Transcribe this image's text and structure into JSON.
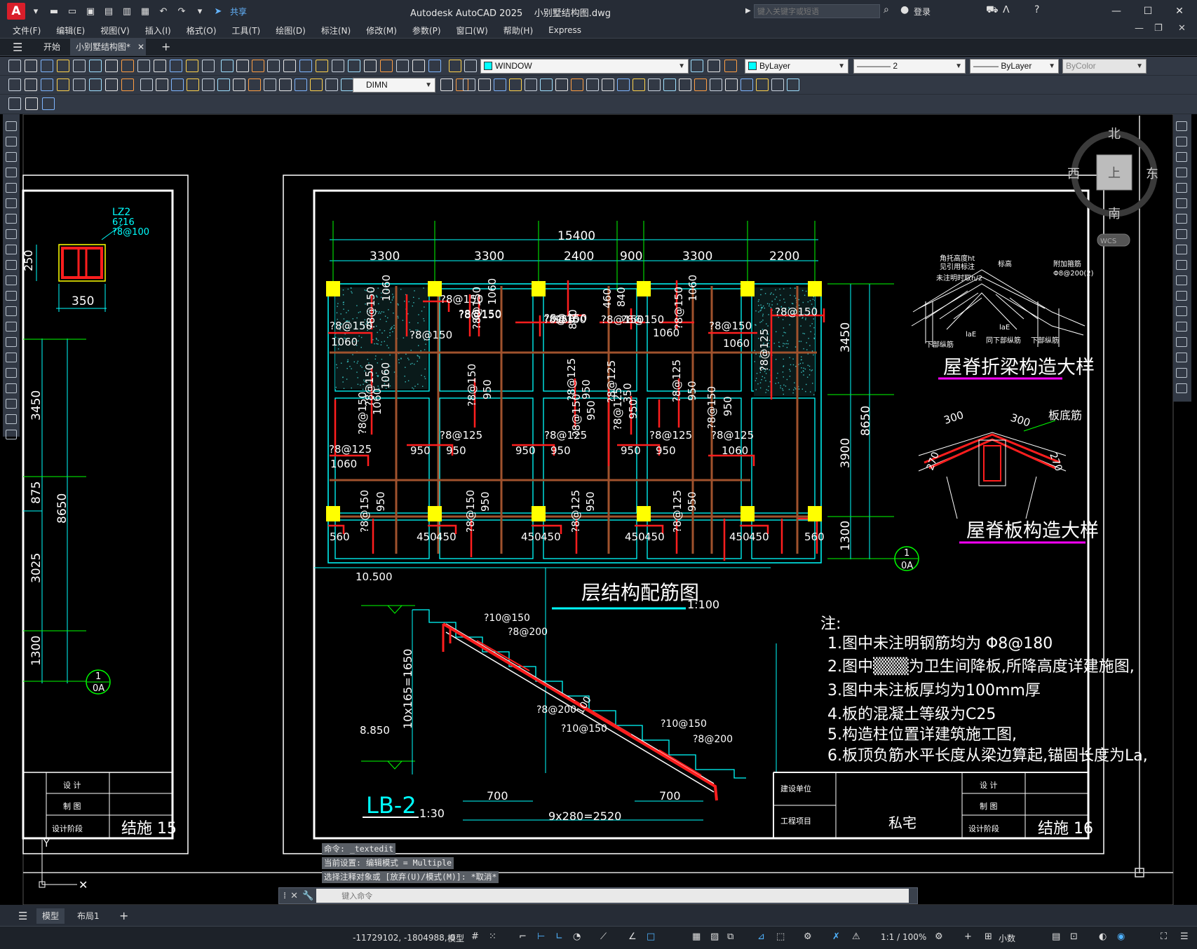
{
  "titlebar": {
    "app_letter": "A",
    "share": "共享",
    "title": "Autodesk AutoCAD 2025    小别墅结构图.dwg",
    "search_placeholder": "键入关键字或短语",
    "login": "登录"
  },
  "menu": [
    "文件(F)",
    "编辑(E)",
    "视图(V)",
    "插入(I)",
    "格式(O)",
    "工具(T)",
    "绘图(D)",
    "标注(N)",
    "修改(M)",
    "参数(P)",
    "窗口(W)",
    "帮助(H)",
    "Express"
  ],
  "tabs": {
    "start": "开始",
    "drawing": "小别墅结构图*"
  },
  "toolbar": {
    "layer_state": "WINDOW",
    "color": "ByLayer",
    "linetype": "———— 2",
    "lineweight": "——— ByLayer",
    "plotstyle": "ByColor",
    "dimstyle": "DIMN"
  },
  "viewcube": {
    "north": "北",
    "south": "南",
    "east": "东",
    "west": "西",
    "top": "上",
    "wcs": "WCS"
  },
  "drawing": {
    "left_sheet": {
      "lz_label": "LZ2",
      "lz_rebar1": "6?16",
      "lz_rebar2": "?8@100",
      "dim_250": "250",
      "dim_350": "350",
      "dim_3450": "3450",
      "dim_875": "875",
      "dim_8650": "8650",
      "dim_3025": "3025",
      "dim_1300": "1300",
      "axis_num": "1",
      "axis_sub": "0A",
      "tb_design": "设 计",
      "tb_draw": "制 图",
      "tb_stage": "设计阶段",
      "sheet_no": "结施 15"
    },
    "plan": {
      "total_width": "15400",
      "bays": [
        "3300",
        "3300",
        "2400",
        "900",
        "3300",
        "2200"
      ],
      "right_dims": [
        "3450",
        "3900",
        "1300"
      ],
      "right_total": "8650",
      "title": "层结构配筋图",
      "scale": "1:100",
      "axis_num": "1",
      "axis_sub": "0A",
      "rebar_labels": [
        "?8@150",
        "?8@125",
        "1060",
        "950",
        "700",
        "840",
        "460",
        "350",
        "560",
        "450"
      ]
    },
    "details": {
      "ridge_beam_title": "屋脊折梁构造大样",
      "ridge_slab_title": "屋脊板构造大样",
      "slab_bottom_rebar": "板底筋",
      "dim_300": "300",
      "dim_270": "270"
    },
    "stair": {
      "elev_top": "10.500",
      "elev_bottom": "8.850",
      "rise": "10x165=1650",
      "run": "9x280=2520",
      "left_700": "700",
      "right_700": "700",
      "label_a": "?10@150",
      "label_b": "?8@200",
      "thickness": "100",
      "title": "LB-2",
      "scale": "1:30"
    },
    "notes": {
      "heading": "注:",
      "items": [
        "1.图中未注明钢筋均为  Φ8@180",
        "2.图中▒▒▒为卫生间降板,所降高度详建施图,",
        "3.图中未注板厚均为100mm厚",
        "4.板的混凝土等级为C25",
        "5.构造柱位置详建筑施工图,",
        "6.板顶负筋水平长度从梁边算起,锚固长度为La,"
      ]
    },
    "title_block": {
      "client": "建设单位",
      "project": "工程项目",
      "project_name": "私宅",
      "design": "设 计",
      "draw": "制 图",
      "stage": "设计阶段",
      "sheet_no": "结施 16"
    }
  },
  "command": {
    "history": [
      "命令: _textedit",
      "当前设置: 编辑模式 = Multiple",
      "选择注释对象或 [放弃(U)/模式(M)]: *取消*"
    ],
    "placeholder": "键入命令"
  },
  "layouts": {
    "model": "模型",
    "layout1": "布局1"
  },
  "status": {
    "coords": "-11729102, -1804988, 0",
    "model": "模型",
    "scale": "1:1 / 100%",
    "units": "小数"
  }
}
